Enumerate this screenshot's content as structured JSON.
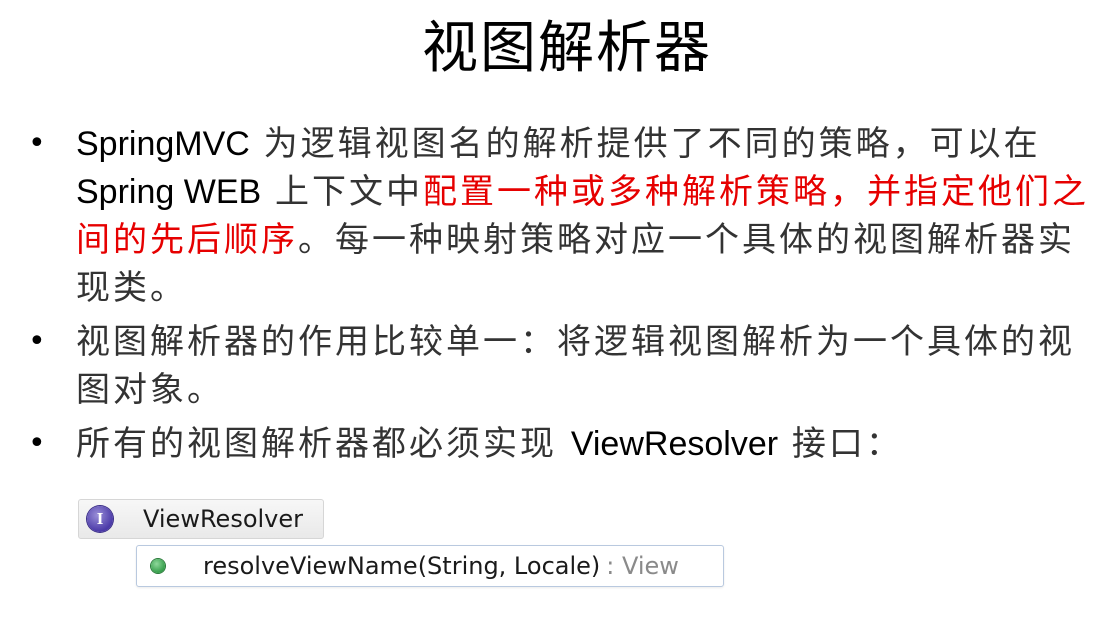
{
  "title": "视图解析器",
  "bullets": [
    {
      "dot": "•",
      "seg1_latin": "SpringMVC",
      "seg2": " 为逻辑视图名的解析提供了不同的策略，可以在 ",
      "seg3_latin": "Spring WEB",
      "seg4": " 上下文中",
      "seg5_red": "配置一种或多种解析策略，并指定他们之间的先后顺序",
      "seg6": "。每一种映射策略对应一个具体的视图解析器实现类。"
    },
    {
      "dot": "•",
      "text": "视图解析器的作用比较单一：将逻辑视图解析为一个具体的视图对象。"
    },
    {
      "dot": "•",
      "seg1": "所有的视图解析器都必须实现 ",
      "seg2_latin": "ViewResolver",
      "seg3": " 接口："
    }
  ],
  "outline": {
    "interface_icon_letter": "I",
    "interface_name": "ViewResolver",
    "method_signature": "resolveViewName(String, Locale)",
    "method_return": ": View"
  },
  "colors": {
    "emphasis": "#e60000",
    "interface_icon": "#4b3aa8",
    "method_icon": "#2f9a45"
  }
}
